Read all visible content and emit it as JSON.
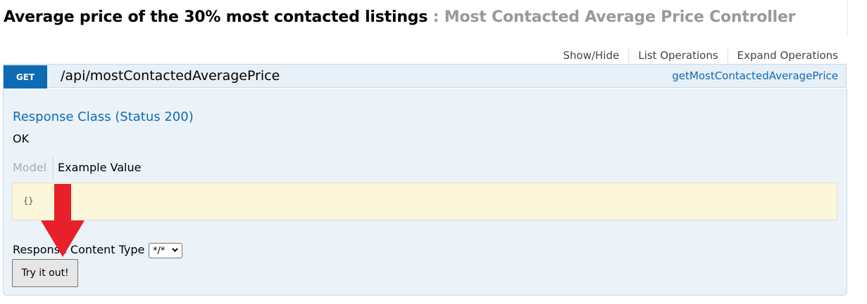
{
  "header": {
    "title": "Average price of the 30% most contacted listings",
    "separator": " : ",
    "controller": "Most Contacted Average Price Controller"
  },
  "operations_bar": {
    "show_hide": "Show/Hide",
    "list_operations": "List Operations",
    "expand_operations": "Expand Operations"
  },
  "operation": {
    "method": "GET",
    "path": "/api/mostContactedAveragePrice",
    "nickname": "getMostContactedAveragePrice",
    "response_class_title": "Response Class (Status 200)",
    "response_description": "OK",
    "tabs": {
      "model": "Model",
      "example_value": "Example Value"
    },
    "example_snippet": "{}",
    "response_content_type_label": "Response Content Type",
    "response_content_type_value": "*/*",
    "try_button": "Try it out!"
  },
  "colors": {
    "get_badge": "#0f6ab4",
    "link": "#0f6ab4",
    "annotation_arrow": "#e8202a",
    "body_bg": "#ebf3f9",
    "snippet_bg": "#fcf6db"
  },
  "annotation": {
    "icon": "red-down-arrow-icon"
  }
}
